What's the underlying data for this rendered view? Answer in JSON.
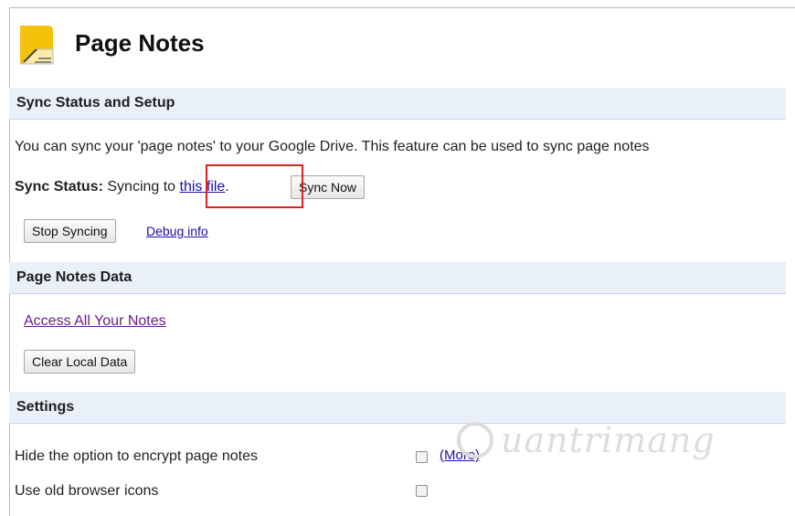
{
  "header": {
    "title": "Page Notes",
    "icon": "notepad-pencil-icon"
  },
  "sync": {
    "section_title": "Sync Status and Setup",
    "description": "You can sync your 'page notes' to your Google Drive. This feature can be used to sync page notes",
    "status_label": "Sync Status:",
    "status_text_before": " Syncing to ",
    "file_link": "this file",
    "status_text_after": ".",
    "sync_now_button": "Sync Now",
    "stop_syncing_button": "Stop Syncing",
    "debug_link": "Debug info"
  },
  "data_section": {
    "section_title": "Page Notes Data",
    "access_link": "Access All Your Notes",
    "clear_button": "Clear Local Data"
  },
  "settings": {
    "section_title": "Settings",
    "items": [
      {
        "label": "Hide the option to encrypt page notes",
        "checked": false,
        "more_link": "(More)"
      },
      {
        "label": "Use old browser icons",
        "checked": false
      }
    ]
  },
  "watermark": {
    "text": "uantrimang"
  },
  "colors": {
    "section_bar": "#eaf0fa",
    "link": "#1a0dab",
    "visited_link": "#6a1a9a",
    "highlight": "#e02020",
    "icon_yellow": "#f4c20d"
  }
}
